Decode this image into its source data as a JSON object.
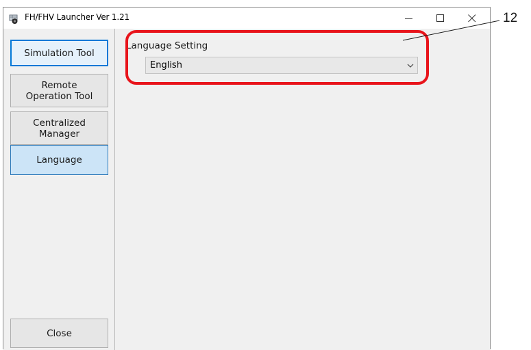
{
  "window": {
    "title": "FH/FHV Launcher Ver 1.21",
    "icons": {
      "app": "launcher-app-icon",
      "minimize": "minimize-icon",
      "maximize": "maximize-icon",
      "close": "close-icon"
    }
  },
  "sidebar": {
    "buttons": [
      {
        "label": "Simulation Tool"
      },
      {
        "label": "Remote Operation Tool"
      },
      {
        "label": "Centralized Manager"
      },
      {
        "label": "Language"
      }
    ],
    "close_label": "Close"
  },
  "content": {
    "language_setting": {
      "label": "Language Setting",
      "selected": "English",
      "chevron_icon": "chevron-down-icon"
    }
  },
  "annotation": {
    "callout_number": "12",
    "highlight_color": "#e8141b"
  },
  "colors": {
    "selected_button_bg": "#cce4f7",
    "selected_button_border": "#2a77b8",
    "primary_focus_border": "#0078d7",
    "window_bg": "#f0f0f0"
  }
}
